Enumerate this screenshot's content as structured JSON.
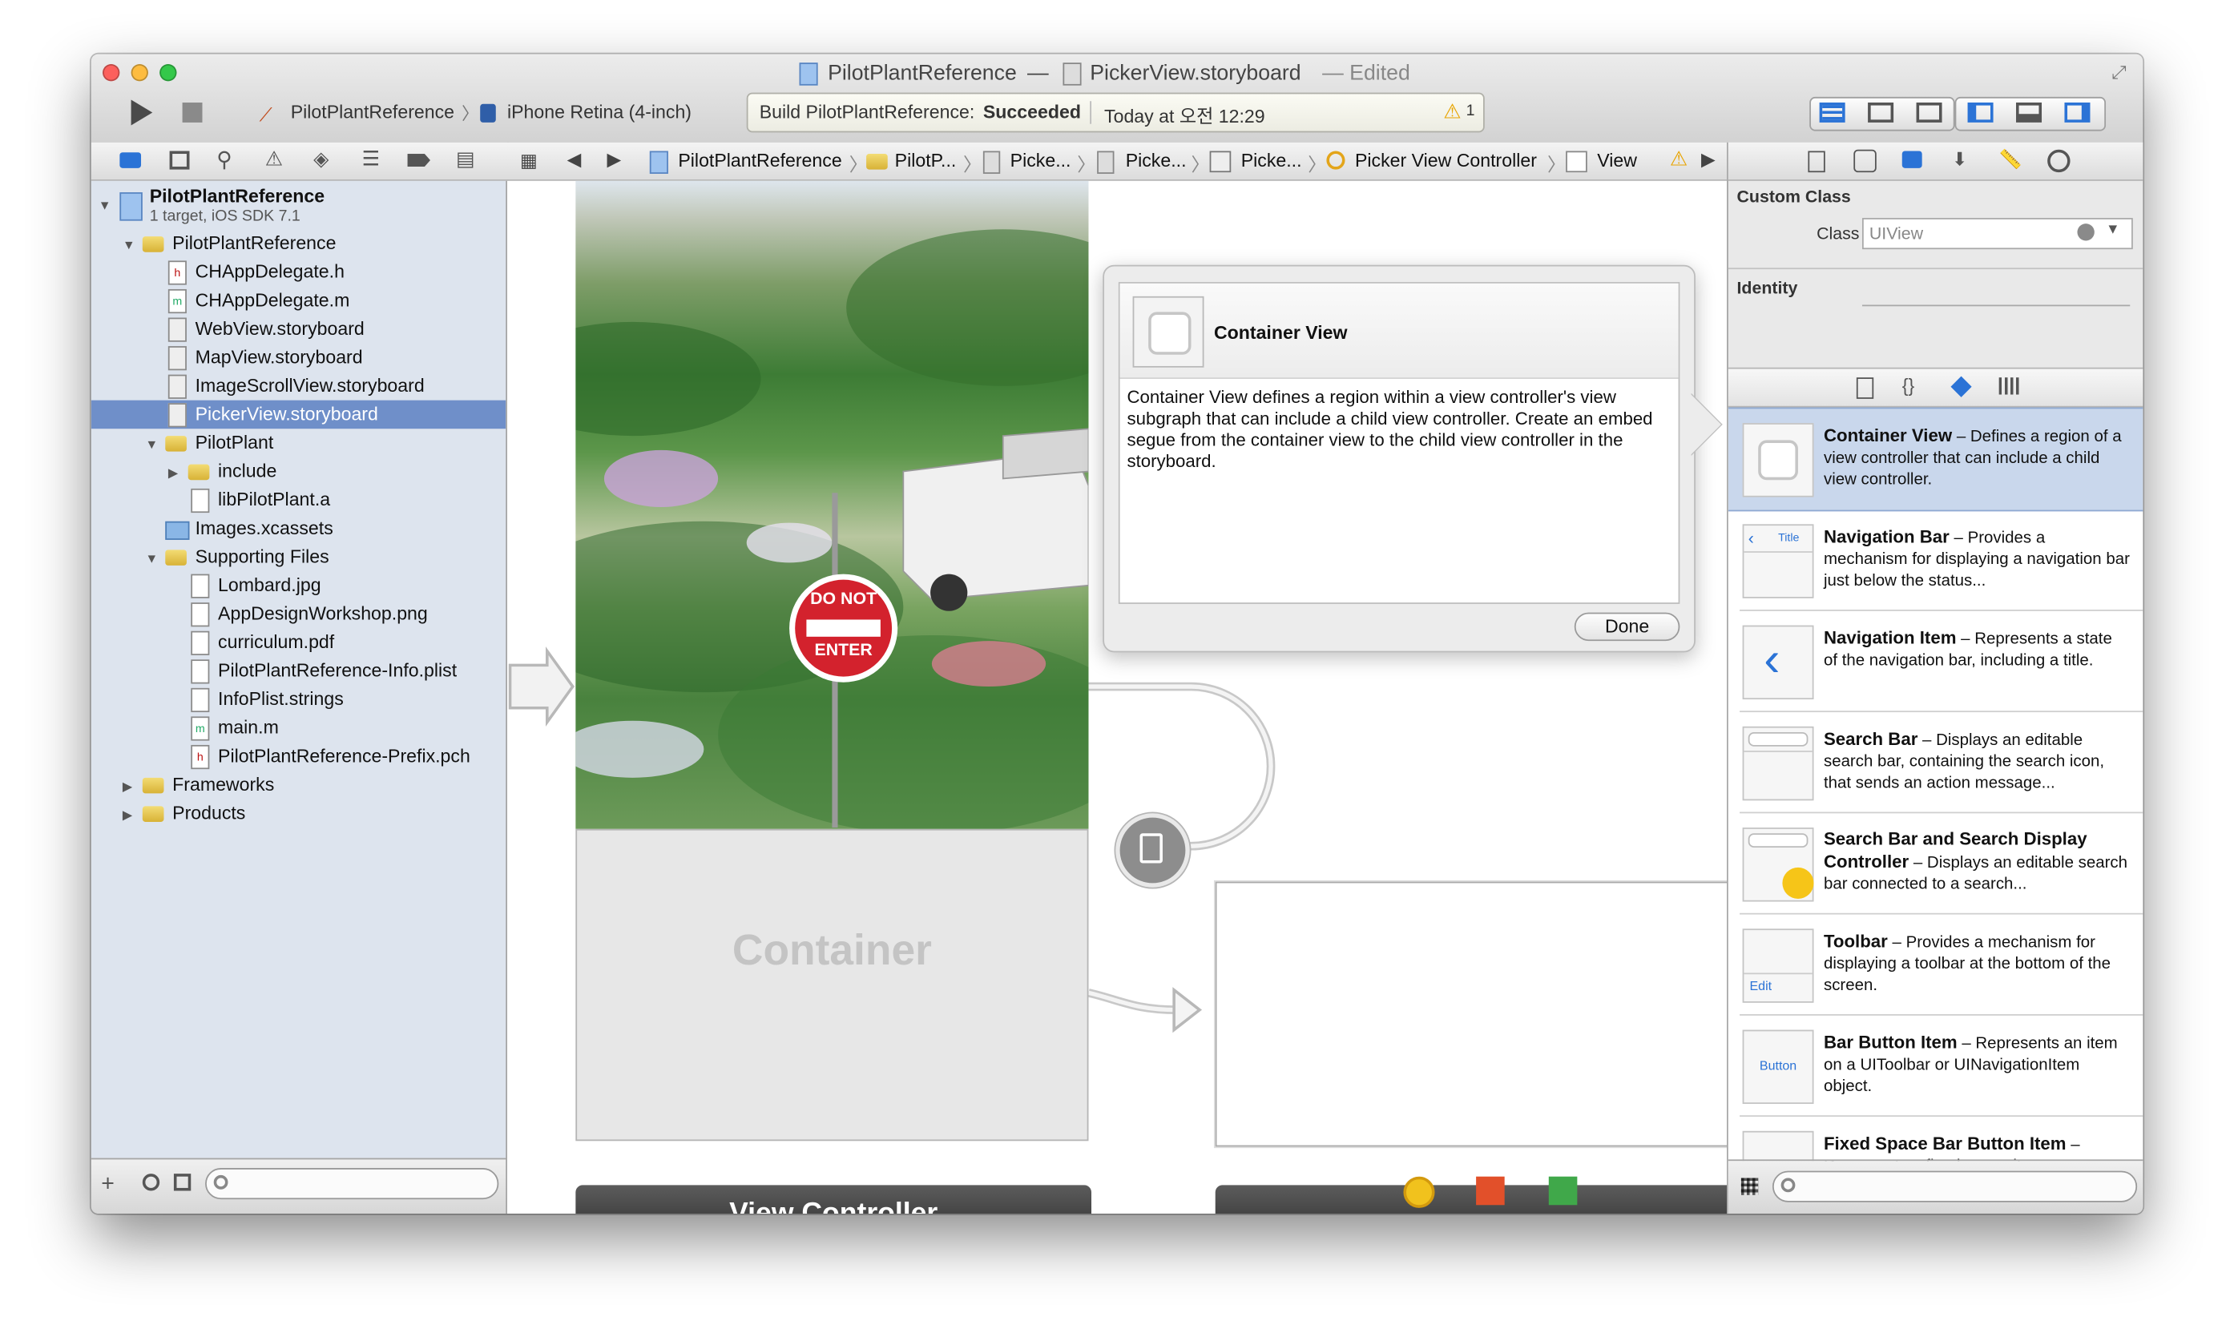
{
  "window": {
    "title_project": "PilotPlantReference",
    "title_dash": "—",
    "title_file": "PickerView.storyboard",
    "title_edited": "— Edited"
  },
  "toolbar": {
    "scheme": "PilotPlantReference",
    "destination": "iPhone Retina (4-inch)",
    "status_prefix": "Build PilotPlantReference:",
    "status_result": "Succeeded",
    "status_time": "Today at 오전 12:29",
    "warning_count": "1"
  },
  "navigator": {
    "project_name": "PilotPlantReference",
    "project_subtitle": "1 target, iOS SDK 7.1",
    "items": [
      {
        "label": "PilotPlantReference"
      },
      {
        "label": "CHAppDelegate.h"
      },
      {
        "label": "CHAppDelegate.m"
      },
      {
        "label": "WebView.storyboard"
      },
      {
        "label": "MapView.storyboard"
      },
      {
        "label": "ImageScrollView.storyboard"
      },
      {
        "label": "PickerView.storyboard"
      },
      {
        "label": "PilotPlant"
      },
      {
        "label": "include"
      },
      {
        "label": "libPilotPlant.a"
      },
      {
        "label": "Images.xcassets"
      },
      {
        "label": "Supporting Files"
      },
      {
        "label": "Lombard.jpg"
      },
      {
        "label": "AppDesignWorkshop.png"
      },
      {
        "label": "curriculum.pdf"
      },
      {
        "label": "PilotPlantReference-Info.plist"
      },
      {
        "label": "InfoPlist.strings"
      },
      {
        "label": "main.m"
      },
      {
        "label": "PilotPlantReference-Prefix.pch"
      },
      {
        "label": "Frameworks"
      },
      {
        "label": "Products"
      }
    ]
  },
  "jumpbar": {
    "crumbs": [
      "PilotPlantReference",
      "PilotP...",
      "Picke...",
      "Picke...",
      "Picke...",
      "Picker View Controller",
      "View"
    ]
  },
  "canvas": {
    "sign_top": "DO NOT",
    "sign_bottom": "ENTER",
    "container_label": "Container",
    "scene_title": "View Controller"
  },
  "popover": {
    "title": "Container View",
    "body": "Container View defines a region within a view controller's view subgraph that can include a child view controller. Create an embed segue from the container view to the child view controller in the storyboard.",
    "done_label": "Done"
  },
  "inspector": {
    "section_custom_class": "Custom Class",
    "class_label": "Class",
    "class_value": "UIView",
    "section_identity": "Identity"
  },
  "library": {
    "items": [
      {
        "title": "Container View",
        "desc": "– Defines a region of a view controller that can include a child view controller."
      },
      {
        "title": "Navigation Bar",
        "desc": "– Provides a mechanism for displaying a navigation bar just below the status...",
        "thumb_text": "Title"
      },
      {
        "title": "Navigation Item",
        "desc": "– Represents a state of the navigation bar, including a title."
      },
      {
        "title": "Search Bar",
        "desc": "– Displays an editable search bar, containing the search icon, that sends an action message..."
      },
      {
        "title": "Search Bar and Search Display Controller",
        "desc": "– Displays an editable search bar connected to a search..."
      },
      {
        "title": "Toolbar",
        "desc": "– Provides a mechanism for displaying a toolbar at the bottom of the screen.",
        "thumb_text": "Edit"
      },
      {
        "title": "Bar Button Item",
        "desc": "– Represents an item on a UIToolbar or UINavigationItem object.",
        "thumb_text": "Button"
      },
      {
        "title": "Fixed Space Bar Button Item",
        "desc": "– Represents a fixed space item on a UIToolbar object."
      }
    ]
  },
  "colors": {
    "selection": "#6f8fc9",
    "library_selection": "#c9d7ec",
    "close": "#fc605c",
    "minimize": "#fdbc40",
    "zoom": "#34c84a",
    "accent_blue": "#2b73d6"
  },
  "icons": [
    "play-icon",
    "stop-icon",
    "warning-icon",
    "folder-icon",
    "file-icon",
    "search-icon",
    "gear-icon",
    "chevron-left-icon",
    "chevron-right-icon",
    "zoom-in-icon",
    "zoom-out-icon",
    "plus-icon",
    "clock-icon",
    "filter-icon",
    "grid-icon"
  ]
}
